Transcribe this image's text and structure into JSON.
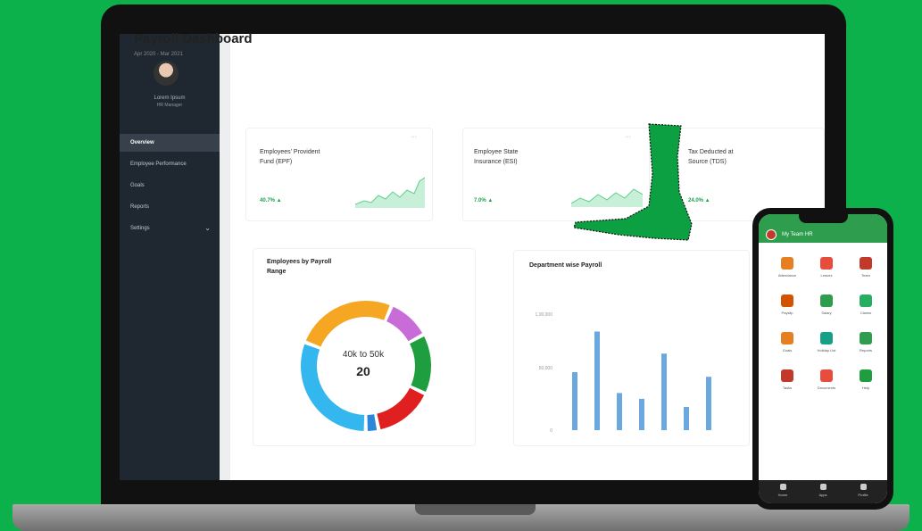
{
  "sidebar": {
    "profile_name": "Lorem Ipsum",
    "profile_role": "HR Manager",
    "items": [
      {
        "label": "Overview",
        "active": true
      },
      {
        "label": "Employee Performance"
      },
      {
        "label": "Goals"
      },
      {
        "label": "Reports"
      },
      {
        "label": "Settings"
      }
    ]
  },
  "header": {
    "title": "Payroll Dashboard",
    "subtitle": "Apr 2020 - Mar 2021"
  },
  "cards": [
    {
      "title_line1": "Employees' Provident",
      "title_line2": "Fund (EPF)",
      "badge": "40.7% ▲"
    },
    {
      "title_line1": "Employee State",
      "title_line2": "Insurance (ESI)",
      "badge": "7.0% ▲"
    },
    {
      "title_line1": "Tax Deducted at",
      "title_line2": "Source (TDS)",
      "badge": "24.0% ▲"
    }
  ],
  "donut": {
    "title_line1": "Employees by Payroll",
    "title_line2": "Range",
    "center_label": "40k to 50k",
    "center_value": "20",
    "segments": [
      {
        "color": "#f5a623",
        "value": 24
      },
      {
        "color": "#c86dd7",
        "value": 10
      },
      {
        "color": "#1e9e3e",
        "value": 14
      },
      {
        "color": "#e02020",
        "value": 14
      },
      {
        "color": "#2b87d9",
        "value": 3
      },
      {
        "color": "#34b7ee",
        "value": 29
      }
    ]
  },
  "bars": {
    "title": "Department wise Payroll",
    "y_ticks": [
      "1,00,000",
      "50,000",
      "0"
    ],
    "values": [
      50,
      85,
      32,
      27,
      66,
      20,
      46
    ],
    "color": "#6aa8df"
  },
  "phone": {
    "title": "My Team HR",
    "grid": [
      {
        "label": "Attendance",
        "color": "#e67e22"
      },
      {
        "label": "Leaves",
        "color": "#e74c3c"
      },
      {
        "label": "Team",
        "color": "#c0392b"
      },
      {
        "label": "Payslip",
        "color": "#d35400"
      },
      {
        "label": "Salary",
        "color": "#2e9d4d"
      },
      {
        "label": "Claims",
        "color": "#27ae60"
      },
      {
        "label": "Goals",
        "color": "#e67e22"
      },
      {
        "label": "Holiday List",
        "color": "#16a085"
      },
      {
        "label": "Reports",
        "color": "#2e9d4d"
      },
      {
        "label": "Tasks",
        "color": "#c0392b"
      },
      {
        "label": "Documents",
        "color": "#e74c3c"
      },
      {
        "label": "Help",
        "color": "#1e9e3e"
      }
    ],
    "bottom_nav": [
      "Home",
      "Apps",
      "Profile"
    ]
  }
}
